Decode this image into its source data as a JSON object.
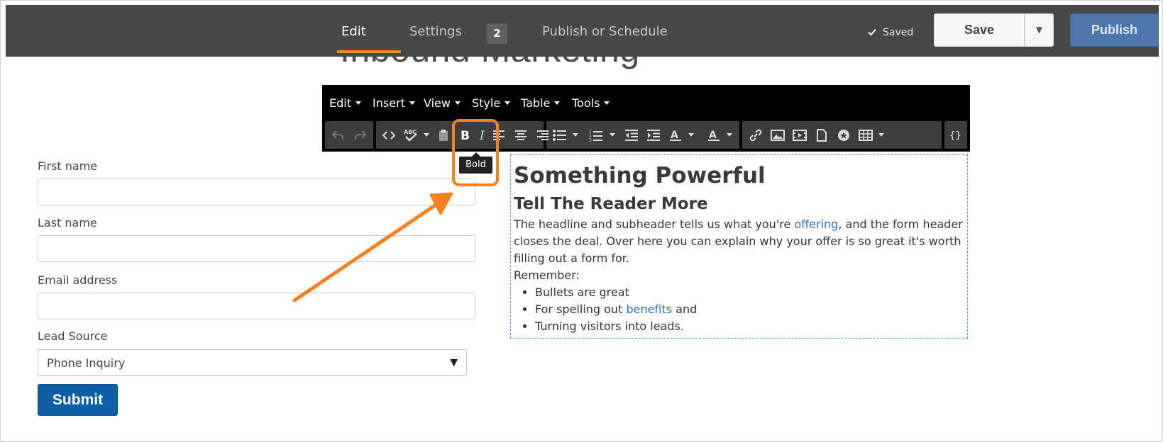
{
  "page": {
    "title_partial": "Inbound Marketing"
  },
  "topbar": {
    "tabs": [
      {
        "label": "Edit",
        "active": true
      },
      {
        "label": "Settings",
        "badge": "2"
      },
      {
        "label": "Publish or Schedule"
      }
    ],
    "saved_label": "Saved",
    "save_label": "Save",
    "publish_label": "Publish",
    "accent_color": "#f2882d"
  },
  "editor": {
    "menu": [
      "Edit",
      "Insert",
      "View",
      "Style",
      "Table",
      "Tools"
    ],
    "toolbar_icons": [
      "undo-icon",
      "redo-icon",
      "source-code-icon",
      "spellcheck-icon",
      "paste-icon",
      "bold-icon",
      "italic-icon",
      "align-left-icon",
      "align-center-icon",
      "align-right-icon",
      "bullet-list-icon",
      "numbered-list-icon",
      "outdent-icon",
      "indent-icon",
      "text-color-icon",
      "background-color-icon",
      "link-icon",
      "image-icon",
      "video-icon",
      "file-icon",
      "cta-icon",
      "table-icon",
      "personalization-token-icon"
    ],
    "tooltip": "Bold",
    "highlight_color": "#f5821f"
  },
  "form": {
    "fields": [
      {
        "label": "First name",
        "value": ""
      },
      {
        "label": "Last name",
        "value": ""
      },
      {
        "label": "Email address",
        "value": ""
      }
    ],
    "lead_source_label": "Lead Source",
    "lead_source_value": "Phone Inquiry",
    "submit_label": "Submit"
  },
  "content": {
    "heading": "Something Powerful",
    "subheading": "Tell The Reader More",
    "para_1_before": "The headline and subheader tells us what you're ",
    "para_1_link": "offering",
    "para_1_after": ", and the form header closes the deal. Over here you can explain why your offer is so great it's worth filling out a form for.",
    "remember": "Remember:",
    "bullets": {
      "b1": "Bullets are great",
      "b2_before": "For spelling out ",
      "b2_link": "benefits",
      "b2_after": " and",
      "b3": "Turning visitors into leads."
    }
  }
}
